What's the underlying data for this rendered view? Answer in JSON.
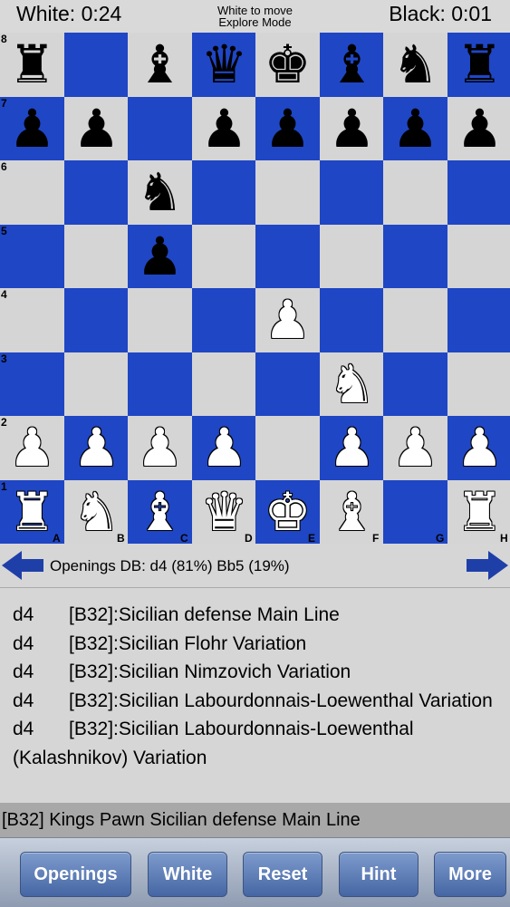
{
  "header": {
    "white_clock": "White: 0:24",
    "black_clock": "Black: 0:01",
    "status_line1": "White to move",
    "status_line2": "Explore Mode"
  },
  "board": {
    "colors": {
      "light": "#d5d5d5",
      "dark": "#1f46c4"
    },
    "ranks": [
      "8",
      "7",
      "6",
      "5",
      "4",
      "3",
      "2",
      "1"
    ],
    "files": [
      "A",
      "B",
      "C",
      "D",
      "E",
      "F",
      "G",
      "H"
    ],
    "pieces": [
      [
        "r",
        "",
        "b",
        "q",
        "k",
        "b",
        "n",
        "r"
      ],
      [
        "p",
        "p",
        "",
        "p",
        "p",
        "p",
        "p",
        "p"
      ],
      [
        "",
        "",
        "n",
        "",
        "",
        "",
        "",
        ""
      ],
      [
        "",
        "",
        "p",
        "",
        "",
        "",
        "",
        ""
      ],
      [
        "",
        "",
        "",
        "",
        "P",
        "",
        "",
        ""
      ],
      [
        "",
        "",
        "",
        "",
        "",
        "N",
        "",
        ""
      ],
      [
        "P",
        "P",
        "P",
        "P",
        "",
        "P",
        "P",
        "P"
      ],
      [
        "R",
        "N",
        "B",
        "Q",
        "K",
        "B",
        "",
        "R"
      ]
    ]
  },
  "nav": {
    "prev_icon": "left-arrow-icon",
    "next_icon": "right-arrow-icon",
    "db_text": "Openings DB: d4 (81%) Bb5 (19%)"
  },
  "openings_list": [
    {
      "move": "d4",
      "name": "[B32]:Sicilian defense Main Line"
    },
    {
      "move": "d4",
      "name": "[B32]:Sicilian Flohr Variation"
    },
    {
      "move": "d4",
      "name": "[B32]:Sicilian Nimzovich Variation"
    },
    {
      "move": "d4",
      "name": "[B32]:Sicilian Labourdonnais-Loewenthal Variation"
    },
    {
      "move": "d4",
      "name": "[B32]:Sicilian Labourdonnais-Loewenthal (Kalashnikov) Variation"
    }
  ],
  "current_opening": "[B32] Kings Pawn Sicilian defense Main Line",
  "toolbar": {
    "openings": "Openings",
    "white": "White",
    "reset": "Reset",
    "hint": "Hint",
    "more": "More"
  }
}
